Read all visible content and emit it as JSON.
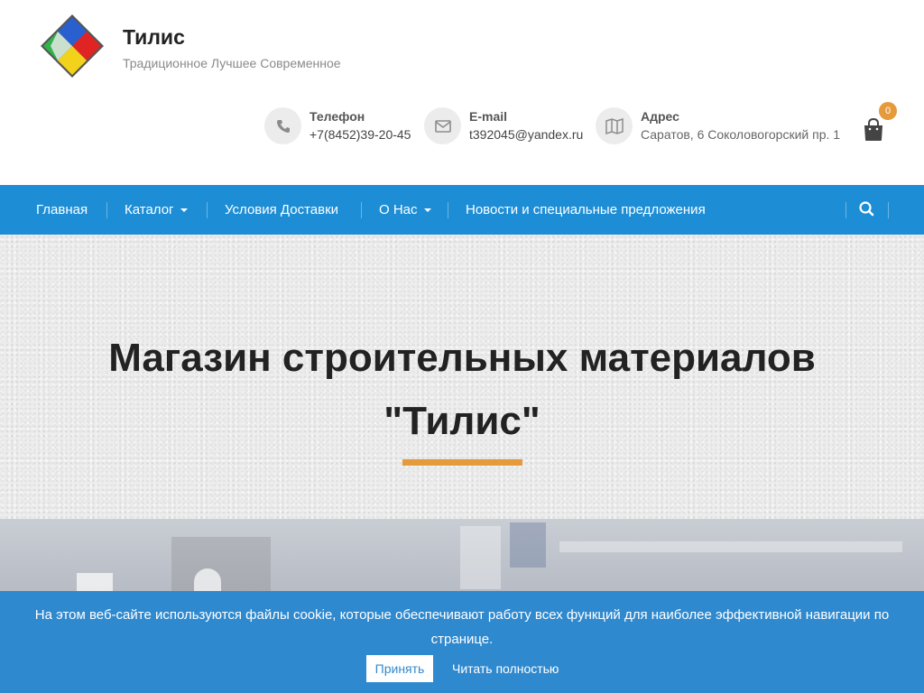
{
  "site": {
    "title": "Тилис",
    "tagline": "Традиционное Лучшее Современное"
  },
  "contacts": [
    {
      "label": "Телефон",
      "value": "+7(8452)39-20-45",
      "icon": "phone-icon"
    },
    {
      "label": "E-mail",
      "value": "t392045@yandex.ru",
      "icon": "envelope-icon"
    },
    {
      "label": "Адрес",
      "value": "Саратов, 6 Соколовогорский пр. 1",
      "icon": "map-icon"
    }
  ],
  "cart": {
    "count": "0",
    "icon": "shopping-bag-icon"
  },
  "nav": {
    "items": [
      {
        "label": "Главная"
      },
      {
        "label": "Каталог"
      },
      {
        "label": "Условия Доставки"
      },
      {
        "label": "О Нас"
      },
      {
        "label": "Новости и специальные предложения"
      }
    ],
    "search_icon": "search-icon"
  },
  "hero": {
    "title_line1": "Магазин строительных материалов",
    "title_line2": "\"Тилис\""
  },
  "cookie": {
    "text": "На этом веб-сайте используются файлы cookie, которые обеспечивают работу всех функций для наиболее эффективной навигации по странице.",
    "accept_label": "Принять",
    "more_label": "Читать полностью"
  },
  "colors": {
    "nav": "#1d8ed6",
    "accent": "#e59a3c",
    "cookie_bar": "#2f89cf"
  }
}
